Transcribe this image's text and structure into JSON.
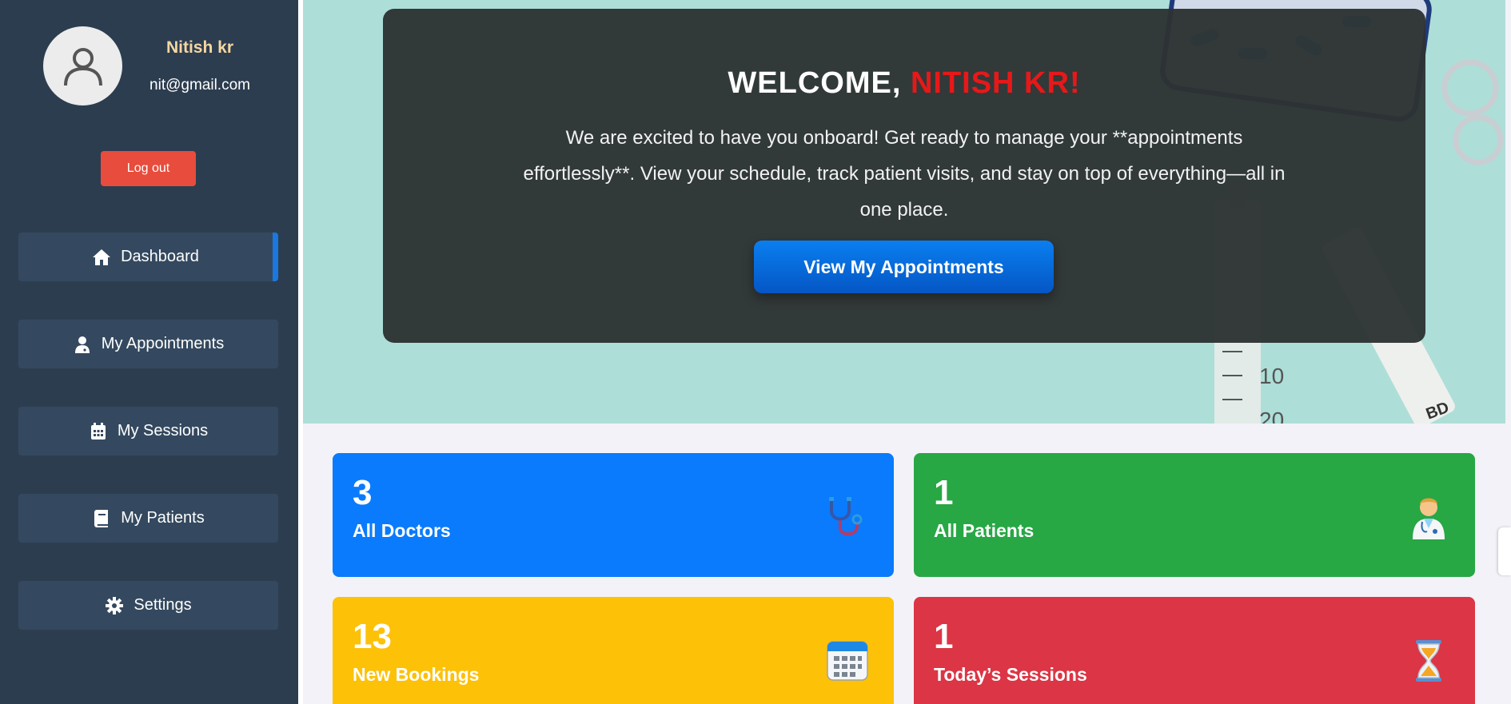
{
  "user": {
    "name": "Nitish kr",
    "email": "nit@gmail.com",
    "logout_label": "Log out"
  },
  "sidebar": {
    "items": [
      {
        "label": "Dashboard",
        "icon": "home-icon",
        "active": true
      },
      {
        "label": "My Appointments",
        "icon": "doctor-icon",
        "active": false
      },
      {
        "label": "My Sessions",
        "icon": "calendar-icon",
        "active": false
      },
      {
        "label": "My Patients",
        "icon": "book-icon",
        "active": false
      },
      {
        "label": "Settings",
        "icon": "gear-icon",
        "active": false
      }
    ]
  },
  "welcome": {
    "prefix": "WELCOME, ",
    "name": "NITISH KR!",
    "text": "We are excited to have you onboard! Get ready to manage your **appointments effortlessly**. View your schedule, track patient visits, and stay on top of everything—all in one place.",
    "button_label": "View My Appointments"
  },
  "stats": [
    {
      "count": "3",
      "label": "All Doctors",
      "icon": "stethoscope-icon",
      "color": "#0a7bfc"
    },
    {
      "count": "1",
      "label": "All Patients",
      "icon": "health-worker-icon",
      "color": "#28a745"
    },
    {
      "count": "13",
      "label": "New Bookings",
      "icon": "calendar-icon",
      "color": "#fdc107"
    },
    {
      "count": "1",
      "label": "Today’s Sessions",
      "icon": "hourglass-icon",
      "color": "#dc3545"
    }
  ],
  "colors": {
    "sidebar_bg": "#2d3d50",
    "nav_item_bg": "#34495f",
    "accent": "#1a78e0",
    "logout": "#e74c3c",
    "name_highlight": "#e81818"
  }
}
